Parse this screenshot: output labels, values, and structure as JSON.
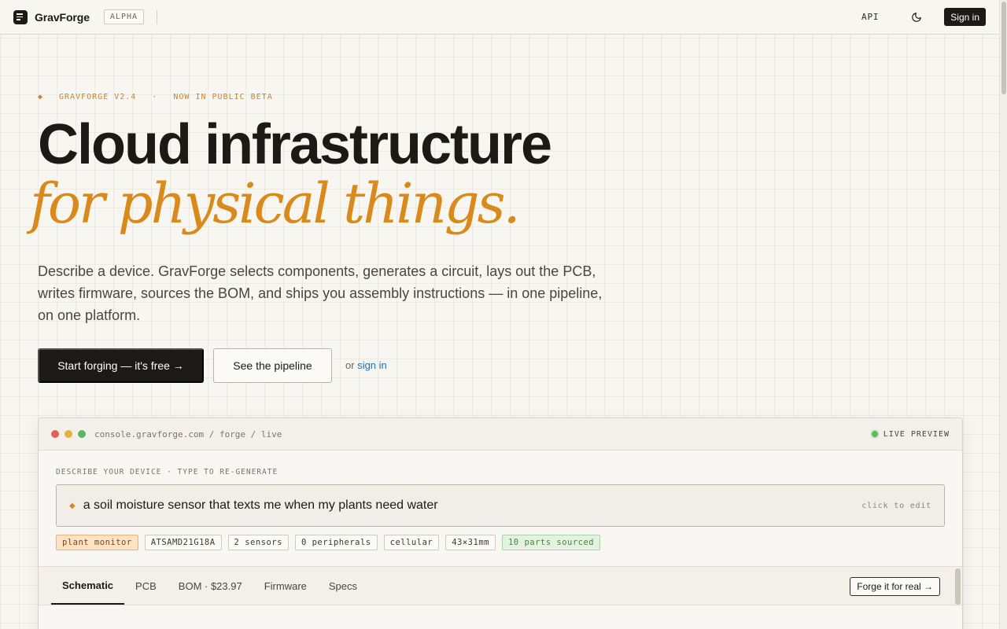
{
  "topbar": {
    "brand": "GravForge",
    "badge": "ALPHA",
    "api_label": "API",
    "signin_label": "Sign in"
  },
  "hero": {
    "eyebrow_version": "GRAVFORGE V2.4",
    "eyebrow_separator": "·",
    "eyebrow_status": "NOW IN PUBLIC BETA",
    "headline_line1": "Cloud infrastructure",
    "headline_line2": "for physical things.",
    "lede": "Describe a device. GravForge selects components, generates a circuit, lays out the PCB, writes firmware, sources the BOM, and ships you assembly instructions — in one pipeline, on one platform.",
    "cta_primary": "Start forging — it's free →",
    "cta_secondary": "See the pipeline",
    "or_text": "or",
    "signin_link": "sign in"
  },
  "console": {
    "url": "console.gravforge.com / forge / live",
    "live_label": "LIVE PREVIEW",
    "describe_label": "DESCRIBE YOUR DEVICE · TYPE TO RE-GENERATE",
    "prompt": "a soil moisture sensor that texts me when my plants need water",
    "click_to_edit": "click to edit",
    "chips": [
      {
        "label": "plant monitor",
        "style": "accent"
      },
      {
        "label": "ATSAMD21G18A",
        "style": "default"
      },
      {
        "label": "2 sensors",
        "style": "default"
      },
      {
        "label": "0 peripherals",
        "style": "default"
      },
      {
        "label": "cellular",
        "style": "default"
      },
      {
        "label": "43×31mm",
        "style": "default"
      },
      {
        "label": "10 parts sourced",
        "style": "green"
      }
    ],
    "tabs": [
      {
        "label": "Schematic",
        "active": true
      },
      {
        "label": "PCB",
        "active": false
      },
      {
        "label": "BOM · $23.97",
        "active": false
      },
      {
        "label": "Firmware",
        "active": false
      },
      {
        "label": "Specs",
        "active": false
      }
    ],
    "forge_button": "Forge it for real →"
  },
  "colors": {
    "accent": "#d98a1c",
    "ink": "#1c1917",
    "link": "#1d6fb8",
    "live": "#5cb85c"
  },
  "icons": {
    "logo": "menu-lines-icon",
    "theme_toggle": "moon-icon",
    "eyebrow_mark": "diamond-icon",
    "prompt_mark": "diamond-icon"
  }
}
